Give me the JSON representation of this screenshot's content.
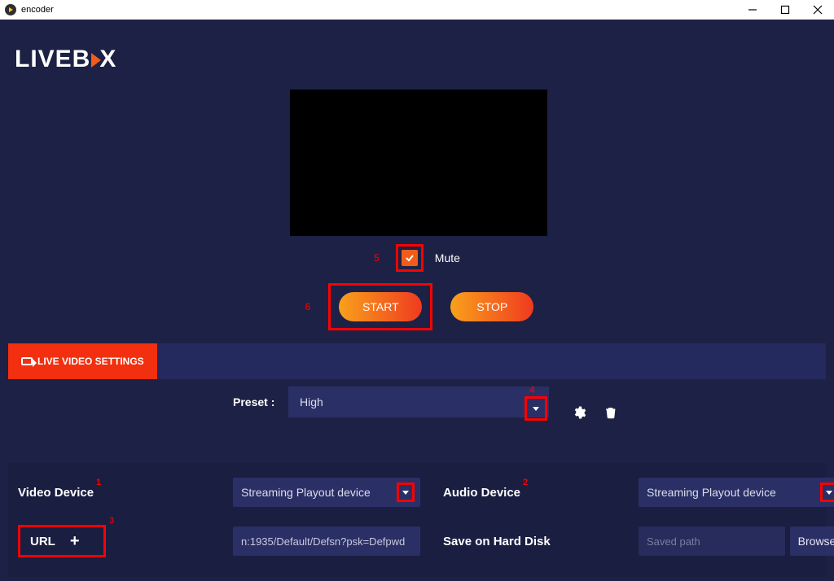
{
  "window": {
    "title": "encoder"
  },
  "logo": {
    "part1": "LIVEB",
    "part2": "X"
  },
  "mute": {
    "label": "Mute",
    "checked": true
  },
  "annotations": {
    "a1": "1",
    "a2": "2",
    "a3": "3",
    "a4": "4",
    "a5": "5",
    "a6": "6"
  },
  "buttons": {
    "start": "START",
    "stop": "STOP",
    "live_video_settings": "LIVE VIDEO SETTINGS",
    "browse": "Browse",
    "url": "URL",
    "plus": "+"
  },
  "preset": {
    "label": "Preset :",
    "value": "High"
  },
  "devices": {
    "video_label": "Video Device",
    "audio_label": "Audio Device",
    "video_value": "Streaming Playout device",
    "audio_value": "Streaming Playout device"
  },
  "url_input": {
    "value": "n:1935/Default/Defsn?psk=Defpwd"
  },
  "save": {
    "label": "Save on Hard Disk",
    "placeholder": "Saved path"
  }
}
